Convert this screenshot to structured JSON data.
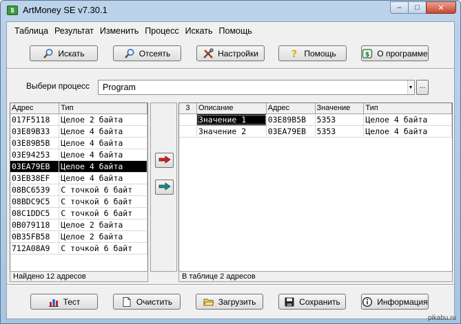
{
  "window": {
    "title": "ArtMoney SE v7.30.1",
    "icon_glyph": "$",
    "min_glyph": "–",
    "max_glyph": "□",
    "close_glyph": "✕"
  },
  "menu": [
    "Таблица",
    "Результат",
    "Изменить",
    "Процесс",
    "Искать",
    "Помощь"
  ],
  "toolbar": {
    "search": "Искать",
    "filter": "Отсеять",
    "settings": "Настройки",
    "help": "Помощь",
    "about": "О программе"
  },
  "process": {
    "label": "Выбери процесс",
    "value": "Program",
    "browse": "..."
  },
  "left_table": {
    "columns": [
      "Адрес",
      "Тип"
    ],
    "rows": [
      [
        "017F5118",
        "Целое 2 байта"
      ],
      [
        "03E89B33",
        "Целое 4 байта"
      ],
      [
        "03E89B5B",
        "Целое 4 байта"
      ],
      [
        "03E94253",
        "Целое 4 байта"
      ],
      [
        "03EA79EB",
        "Целое 4 байта"
      ],
      [
        "03EB38EF",
        "Целое 4 байта"
      ],
      [
        "08BC6539",
        "С точкой 6 байт"
      ],
      [
        "08BDC9C5",
        "С точкой 6 байт"
      ],
      [
        "08C1DDC5",
        "С точкой 6 байт"
      ],
      [
        "0B079118",
        "Целое 2 байта"
      ],
      [
        "0B35FB58",
        "Целое 2 байта"
      ],
      [
        "712A08A9",
        "С точкой 6 байт"
      ]
    ],
    "selected_row": 4,
    "status": "Найдено 12 адресов"
  },
  "right_table": {
    "columns": [
      "3",
      "Описание",
      "Адрес",
      "Значение",
      "Тип"
    ],
    "rows": [
      [
        "",
        "Значение 1",
        "03E89B5B",
        "5353",
        "Целое 4 байта"
      ],
      [
        "",
        "Значение 2",
        "03EA79EB",
        "5353",
        "Целое 4 байта"
      ]
    ],
    "status": "В таблице 2 адресов"
  },
  "bottom_bar": {
    "test": "Тест",
    "clear": "Очистить",
    "load": "Загрузить",
    "save": "Сохранить",
    "info": "Информация"
  },
  "watermark": "pikabu.ru",
  "colors": {
    "selection": "#000000",
    "arrow_red": "#d22020",
    "arrow_teal": "#1a8a8a"
  }
}
